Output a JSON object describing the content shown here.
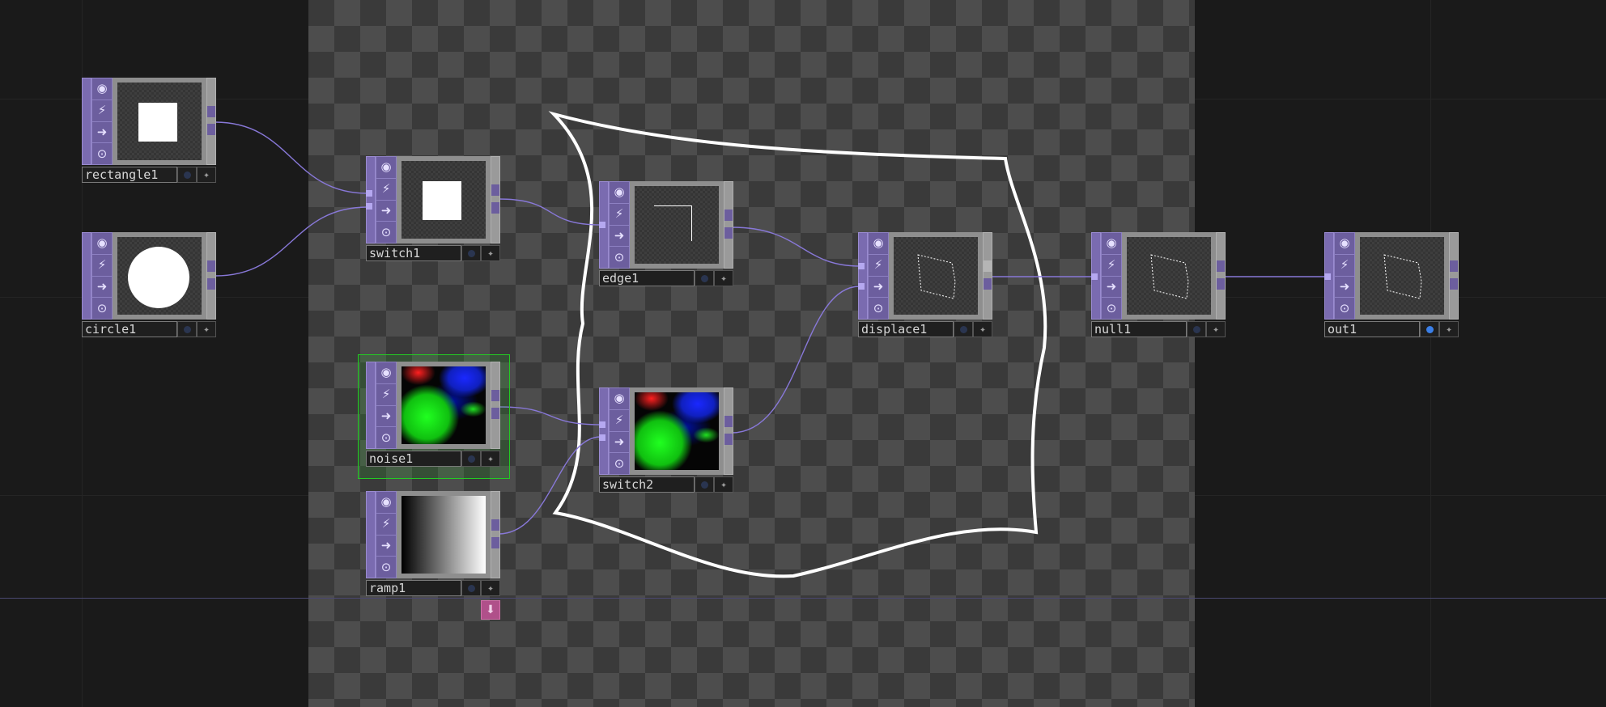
{
  "canvas": {
    "background": "#1a1a1a",
    "checker_light": "#4d4d4d",
    "checker_dark": "#3a3a3a"
  },
  "colors": {
    "wire": "#8878d8",
    "selection": "#22cc22",
    "node_strip": "#7a6bb0",
    "viewer_flag_on": "#3a7fe8"
  },
  "node_icons": [
    "circle-target-icon",
    "lightning-icon",
    "arrow-right-icon",
    "lock-open-icon"
  ],
  "icon_glyphs": {
    "circle-target-icon": "◉",
    "lightning-icon": "⚡",
    "arrow-right-icon": "➜",
    "lock-open-icon": "🔓"
  },
  "nodes": {
    "rectangle1": {
      "name": "rectangle1",
      "preview": "white-square"
    },
    "circle1": {
      "name": "circle1",
      "preview": "white-circle"
    },
    "switch1": {
      "name": "switch1",
      "preview": "white-square"
    },
    "noise1": {
      "name": "noise1",
      "preview": "color-noise",
      "selected": true
    },
    "ramp1": {
      "name": "ramp1",
      "preview": "horizontal-ramp"
    },
    "edge1": {
      "name": "edge1",
      "preview": "edge-corner"
    },
    "switch2": {
      "name": "switch2",
      "preview": "color-noise"
    },
    "displace1": {
      "name": "displace1",
      "preview": "dashed-outline"
    },
    "null1": {
      "name": "null1",
      "preview": "dashed-outline"
    },
    "out1": {
      "name": "out1",
      "preview": "dashed-outline",
      "viewer_active": true
    }
  },
  "extra_button": {
    "icon": "down-arrow-icon",
    "glyph": "⬇"
  }
}
